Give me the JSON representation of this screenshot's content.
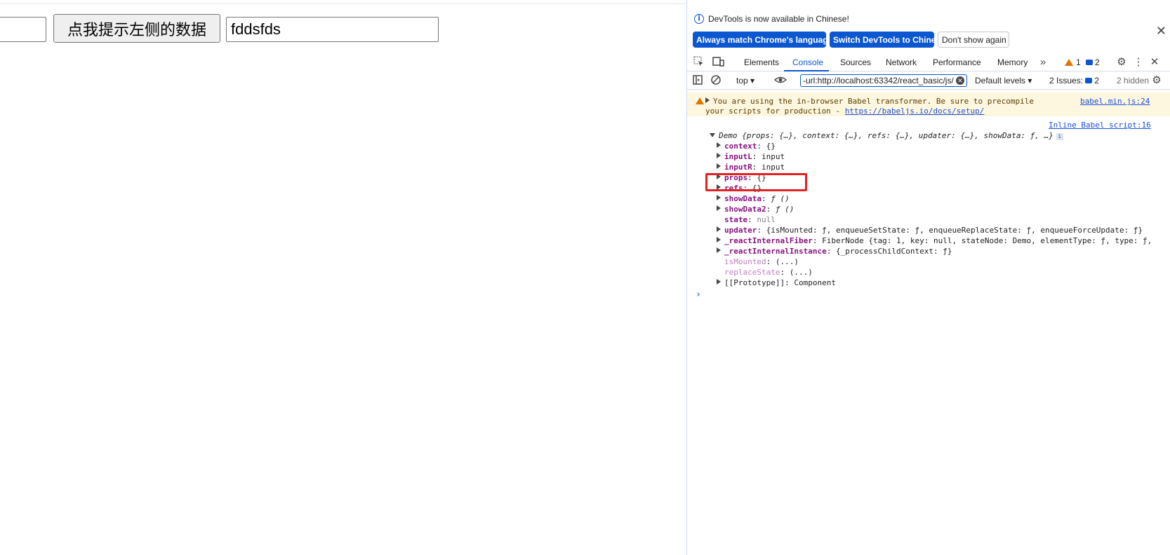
{
  "page": {
    "button_label": "点我提示左侧的数据",
    "input_right_value": "fddsfds"
  },
  "devtools": {
    "infobar": {
      "message": "DevTools is now available in Chinese!",
      "btn_match": "Always match Chrome's language",
      "btn_switch": "Switch DevTools to Chinese",
      "btn_dont_show": "Don't show again"
    },
    "tabs": [
      "Elements",
      "Console",
      "Sources",
      "Network",
      "Performance",
      "Memory"
    ],
    "active_tab": "Console",
    "warning_count": "1",
    "message_count": "2",
    "toolbar": {
      "context": "top",
      "filter_value": "-url:http://localhost:63342/react_basic/js/",
      "levels": "Default levels",
      "issues_label": "2 Issues:",
      "issues_count": "2",
      "hidden": "2 hidden"
    },
    "console": {
      "warning_text": "You are using the in-browser Babel transformer. Be sure to precompile your scripts for production - ",
      "warning_link": "https://babeljs.io/docs/setup/",
      "warning_source": "babel.min.js:24",
      "log_source": "Inline Babel script:16",
      "object_summary": "Demo {props: {…}, context: {…}, refs: {…}, updater: {…}, showData: ƒ, …}",
      "props": [
        {
          "key": "context",
          "value": "{}",
          "expandable": true
        },
        {
          "key": "inputL",
          "value": "input",
          "expandable": true
        },
        {
          "key": "inputR",
          "value": "input",
          "expandable": true
        },
        {
          "key": "props",
          "value": "{}",
          "expandable": true
        },
        {
          "key": "refs",
          "value": "{}",
          "expandable": true
        },
        {
          "key": "showData",
          "value": "ƒ ()",
          "expandable": true
        },
        {
          "key": "showData2",
          "value": "ƒ ()",
          "expandable": true
        },
        {
          "key": "state",
          "value": "null",
          "expandable": false
        },
        {
          "key": "updater",
          "value": "{isMounted: ƒ, enqueueSetState: ƒ, enqueueReplaceState: ƒ, enqueueForceUpdate: ƒ}",
          "expandable": true
        },
        {
          "key": "_reactInternalFiber",
          "value": "FiberNode {tag: 1, key: null, stateNode: Demo, elementType: ƒ, type: ƒ,",
          "expandable": true
        },
        {
          "key": "_reactInternalInstance",
          "value": "{_processChildContext: ƒ}",
          "expandable": true
        },
        {
          "key": "isMounted",
          "value": "(...)",
          "expandable": false
        },
        {
          "key": "replaceState",
          "value": "(...)",
          "expandable": false
        },
        {
          "key": "[[Prototype]]",
          "value": "Component",
          "expandable": true
        }
      ]
    }
  },
  "colors": {
    "accent": "#0b57d0",
    "highlight": "#e62020",
    "warning_bg": "#fef7e0",
    "key": "#881280"
  }
}
